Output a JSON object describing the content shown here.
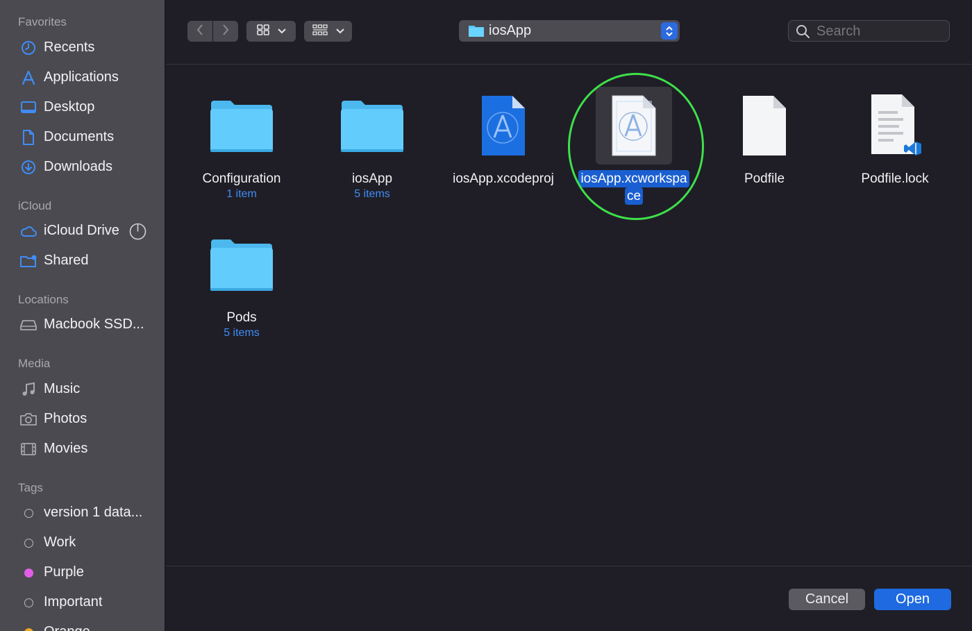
{
  "sidebar": {
    "favorites_title": "Favorites",
    "favorites": [
      {
        "label": "Recents",
        "icon": "clock-icon"
      },
      {
        "label": "Applications",
        "icon": "applications-icon"
      },
      {
        "label": "Desktop",
        "icon": "desktop-icon"
      },
      {
        "label": "Documents",
        "icon": "document-icon"
      },
      {
        "label": "Downloads",
        "icon": "download-icon"
      }
    ],
    "icloud_title": "iCloud",
    "icloud": [
      {
        "label": "iCloud Drive",
        "icon": "cloud-icon"
      },
      {
        "label": "Shared",
        "icon": "shared-folder-icon"
      }
    ],
    "locations_title": "Locations",
    "locations": [
      {
        "label": "Macbook SSD...",
        "icon": "disk-icon"
      }
    ],
    "media_title": "Media",
    "media": [
      {
        "label": "Music",
        "icon": "music-icon"
      },
      {
        "label": "Photos",
        "icon": "camera-icon"
      },
      {
        "label": "Movies",
        "icon": "film-icon"
      }
    ],
    "tags_title": "Tags",
    "tags": [
      {
        "label": "version 1 data...",
        "color": "none"
      },
      {
        "label": "Work",
        "color": "none"
      },
      {
        "label": "Purple",
        "color": "#e35ee8"
      },
      {
        "label": "Important",
        "color": "none"
      },
      {
        "label": "Orange",
        "color": "#f5a623"
      }
    ]
  },
  "toolbar": {
    "current_folder": "iosApp",
    "search_placeholder": "Search"
  },
  "files": [
    {
      "name": "Configuration",
      "sub": "1 item",
      "kind": "folder"
    },
    {
      "name": "iosApp",
      "sub": "5 items",
      "kind": "folder"
    },
    {
      "name": "iosApp.xcodeproj",
      "sub": "",
      "kind": "xcodeproj"
    },
    {
      "name": "iosApp.xcworkspa",
      "name2": "ce",
      "sub": "",
      "kind": "xcworkspace",
      "selected": true
    },
    {
      "name": "Podfile",
      "sub": "",
      "kind": "file"
    },
    {
      "name": "Podfile.lock",
      "sub": "",
      "kind": "lock"
    },
    {
      "name": "Pods",
      "sub": "5 items",
      "kind": "folder"
    }
  ],
  "footer": {
    "cancel_label": "Cancel",
    "open_label": "Open"
  },
  "colors": {
    "accent": "#2c6ae0",
    "folder": "#5ac8fa",
    "highlight_circle": "#3ee04a"
  }
}
